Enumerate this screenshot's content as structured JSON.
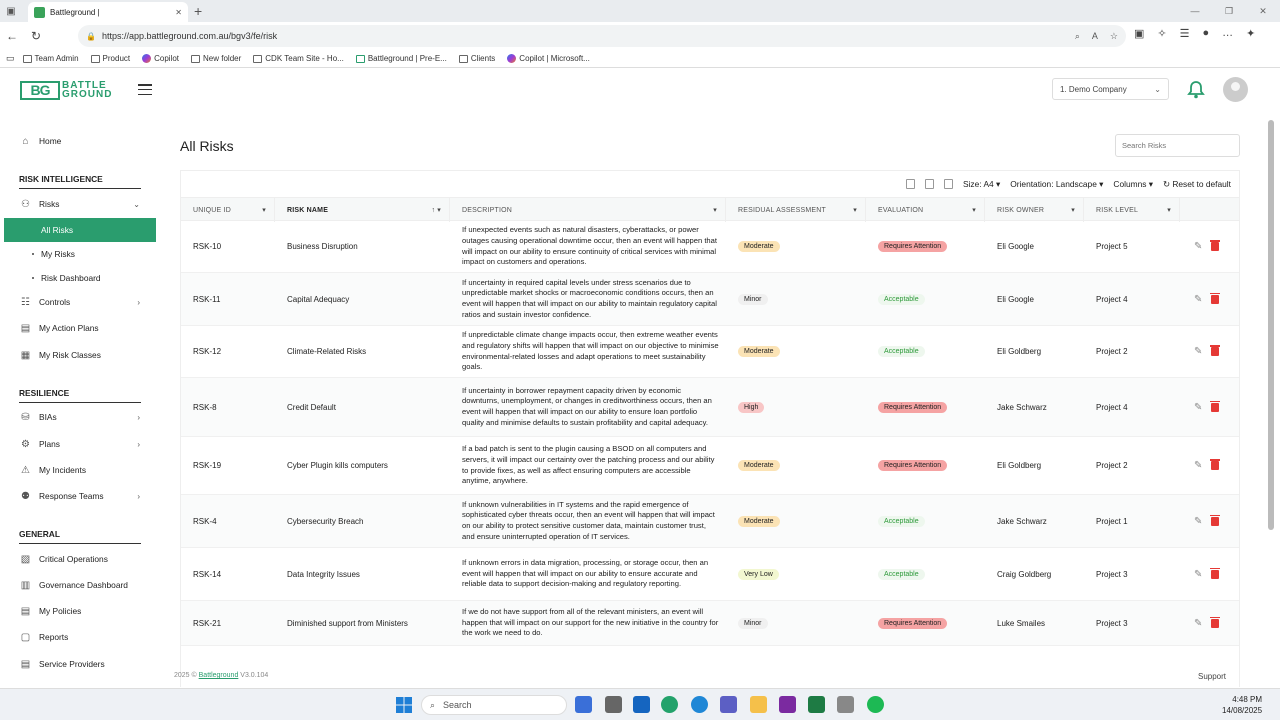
{
  "browser": {
    "tab_title": "Battleground |",
    "url": "https://app.battleground.com.au/bgv3/fe/risk",
    "bookmarks": [
      "Team Admin",
      "Product",
      "Copilot",
      "New folder",
      "CDK Team Site - Ho...",
      "Battleground | Pre-E...",
      "Clients",
      "Copilot | Microsoft..."
    ]
  },
  "header": {
    "logo_text_1": "BATTLE",
    "logo_text_2": "GROUND",
    "company": "1. Demo Company"
  },
  "sidebar": {
    "home": "Home",
    "sec_risk_intel": "RISK INTELLIGENCE",
    "risks": "Risks",
    "all_risks": "All Risks",
    "my_risks": "My Risks",
    "risk_dashboard": "Risk Dashboard",
    "controls": "Controls",
    "my_action_plans": "My Action Plans",
    "my_risk_classes": "My Risk Classes",
    "sec_resilience": "RESILIENCE",
    "bias": "BIAs",
    "plans": "Plans",
    "my_incidents": "My Incidents",
    "response_teams": "Response Teams",
    "sec_general": "GENERAL",
    "critical_operations": "Critical Operations",
    "governance_dashboard": "Governance Dashboard",
    "my_policies": "My Policies",
    "reports": "Reports",
    "service_providers": "Service Providers"
  },
  "main": {
    "title": "All Risks",
    "search_placeholder": "Search Risks",
    "toolbar": {
      "size_label": "Size:",
      "size_value": "A4",
      "orientation_label": "Orientation:",
      "orientation_value": "Landscape",
      "columns": "Columns",
      "reset": "Reset to default"
    },
    "columns": [
      "UNIQUE ID",
      "RISK NAME",
      "DESCRIPTION",
      "RESIDUAL ASSESSMENT",
      "EVALUATION",
      "RISK OWNER",
      "RISK LEVEL"
    ],
    "rows": [
      {
        "id": "RSK-10",
        "name": "Business Disruption",
        "desc": "If unexpected events such as natural disasters, cyberattacks, or power outages causing operational downtime occur, then an event will happen that will impact on our ability to ensure continuity of critical services with minimal impact on customers and operations.",
        "residual": "Moderate",
        "evaluation": "Requires Attention",
        "owner": "Eli Google",
        "level": "Project 5"
      },
      {
        "id": "RSK-11",
        "name": "Capital Adequacy",
        "desc": "If uncertainty in required capital levels under stress scenarios due to unpredictable market shocks or macroeconomic conditions occurs, then an event will happen that will impact on our ability to maintain regulatory capital ratios and sustain investor confidence.",
        "residual": "Minor",
        "evaluation": "Acceptable",
        "owner": "Eli Google",
        "level": "Project 4"
      },
      {
        "id": "RSK-12",
        "name": "Climate-Related Risks",
        "desc": "If unpredictable climate change impacts occur, then extreme weather events and regulatory shifts will happen that will impact on our objective to minimise environmental-related losses and adapt operations to meet sustainability goals.",
        "residual": "Moderate",
        "evaluation": "Acceptable",
        "owner": "Eli Goldberg",
        "level": "Project 2"
      },
      {
        "id": "RSK-8",
        "name": "Credit Default",
        "desc": "If uncertainty in borrower repayment capacity driven by economic downturns, unemployment, or changes in creditworthiness occurs, then an event will happen that will impact on our ability to ensure loan portfolio quality and minimise defaults to sustain profitability and capital adequacy.",
        "residual": "High",
        "evaluation": "Requires Attention",
        "owner": "Jake Schwarz",
        "level": "Project 4"
      },
      {
        "id": "RSK-19",
        "name": "Cyber Plugin kills computers",
        "desc": "If a bad patch is sent to the plugin causing a BSOD on all computers and servers, it will impact our certainty over the patching process and our ability to provide fixes, as well as affect ensuring computers are accessible anytime, anywhere.",
        "residual": "Moderate",
        "evaluation": "Requires Attention",
        "owner": "Eli Goldberg",
        "level": "Project 2"
      },
      {
        "id": "RSK-4",
        "name": "Cybersecurity Breach",
        "desc": "If unknown vulnerabilities in IT systems and the rapid emergence of sophisticated cyber threats occur, then an event will happen that will impact on our ability to protect sensitive customer data, maintain customer trust, and ensure uninterrupted operation of IT services.",
        "residual": "Moderate",
        "evaluation": "Acceptable",
        "owner": "Jake Schwarz",
        "level": "Project 1"
      },
      {
        "id": "RSK-14",
        "name": "Data Integrity Issues",
        "desc": "If unknown errors in data migration, processing, or storage occur, then an event will happen that will impact on our ability to ensure accurate and reliable data to support decision-making and regulatory reporting.",
        "residual": "Very Low",
        "evaluation": "Acceptable",
        "owner": "Craig Goldberg",
        "level": "Project 3"
      },
      {
        "id": "RSK-21",
        "name": "Diminished support from Ministers",
        "desc": "If we do not have support from all of the relevant ministers, an event will happen that will impact on our support for the new initiative in the country for the work we need to do.",
        "residual": "Minor",
        "evaluation": "Requires Attention",
        "owner": "Luke Smailes",
        "level": "Project 3"
      }
    ]
  },
  "footer": {
    "copyright": "2025 ©",
    "brand": "Battleground",
    "version": "V3.0.104",
    "support": "Support"
  },
  "taskbar": {
    "search": "Search",
    "time": "4:48 PM",
    "date": "14/08/2025"
  },
  "colors": {
    "brand": "#2a9d6e",
    "moderate": "#fbe3b5",
    "minor": "#f0f0f0",
    "high": "#f8c6c6",
    "very_low": "#f2f7d0",
    "requires_attention": "#f5a3a3",
    "acceptable_text": "#2e9a3a"
  }
}
